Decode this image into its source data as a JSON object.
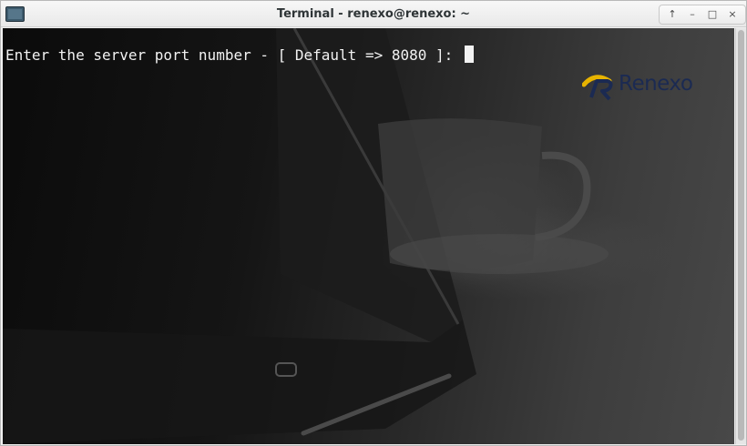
{
  "window": {
    "title": "Terminal - renexo@renexo: ~",
    "icon": "terminal-app-icon",
    "controls": {
      "up": "↑",
      "minimize": "–",
      "maximize": "□",
      "close": "×"
    }
  },
  "terminal": {
    "prompt_text": "Enter the server port number - [ Default => 8080 ]: ",
    "background_image": "laptop-and-coffee-cup-wallpaper",
    "logo_text": "Renexo",
    "colors": {
      "foreground": "#f2f2f2",
      "logo_text": "#1b2a52",
      "logo_swoosh": "#e8b400"
    }
  }
}
